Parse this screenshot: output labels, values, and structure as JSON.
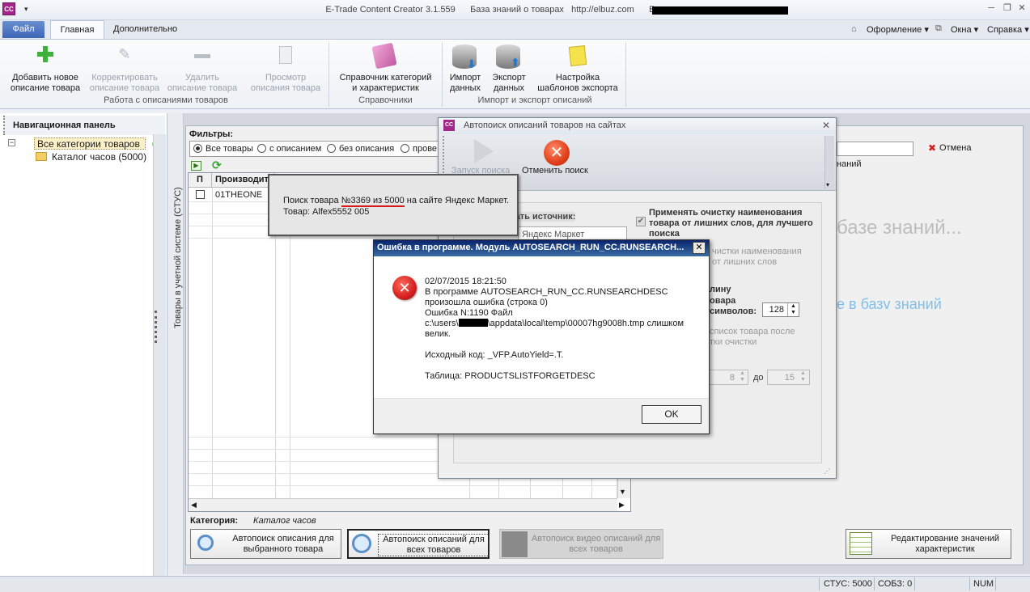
{
  "titlebar": {
    "app_icon": "CC",
    "quick_access": "▾",
    "title": "E-Trade Content Creator 3.1.559      База знаний о товарах   http://elbuz.com      База данных:"
  },
  "tabs": {
    "file": "Файл",
    "home": "Главная",
    "more": "Дополнительно",
    "right": [
      "Оформление ▾",
      "Окна ▾",
      "Справка ▾"
    ]
  },
  "ribbon": {
    "add": [
      "Добавить новое",
      "описание товара"
    ],
    "edit": [
      "Корректировать",
      "описание товара"
    ],
    "delete": [
      "Удалить",
      "описание товара"
    ],
    "view": [
      "Просмотр",
      "описания товара"
    ],
    "refs": [
      "Справочник категорий",
      "и характеристик"
    ],
    "import": [
      "Импорт",
      "данных"
    ],
    "export": [
      "Экспорт",
      "данных"
    ],
    "templates": [
      "Настройка",
      "шаблонов экспорта"
    ],
    "group1": "Работа с описаниями товаров",
    "group2": "Справочники",
    "group3": "Импорт и экспорт описаний"
  },
  "nav": {
    "header": "Навигационная панель",
    "all_categories": "Все категории товаров",
    "watch_catalog": "Каталог часов (5000)",
    "vertical_tab": "Товары в учетной системе (СТУС)"
  },
  "filters": {
    "label": "Фильтры:",
    "options": [
      "Все товары",
      "с описанием",
      "без описания",
      "прове"
    ]
  },
  "grid": {
    "col_p": "П",
    "col_maker": "Производит",
    "row1_maker": "01THEONE"
  },
  "category": {
    "label": "Категория:",
    "value": "Каталог часов"
  },
  "bottom_buttons": {
    "autosearch_selected": [
      "Автопоиск описания для",
      "выбранного товара"
    ],
    "autosearch_all": [
      "Автопоиск описаний для",
      "всех товаров"
    ],
    "autosearch_video": [
      "Автопоиск видео описаний для",
      "всех товаров"
    ],
    "edit_values": [
      "Редактирование значений",
      "характеристик"
    ]
  },
  "autosearch": {
    "title": "Автопоиск описаний товаров на сайтах",
    "start": "Запуск поиска",
    "cancel": "Отменить поиск",
    "source_label": "вать источник:",
    "source_value": "Яндекс Маркет",
    "apply_clean": "Применять очистку наименования товара от лишних слов, для лучшего поиска",
    "clean_opt1": "чистки наименования",
    "clean_opt1b": "от лишних слов",
    "length_a": "лину",
    "length_b": "овара",
    "length_c": "символов:",
    "length_value": "128",
    "list_opt": "список товара после",
    "list_opt2": "тки очистки",
    "range_from": "8",
    "range_to_label": "до",
    "range_to": "15"
  },
  "background_right": {
    "cancel": "Отмена",
    "knowledge_partial": "наний",
    "big_text": "базе знаний...",
    "blue_text": "е в базv знаний"
  },
  "progress": {
    "line1_pre": "Поиск товара ",
    "line1_num": "№3369 из 5000",
    "line1_post": " на сайте Яндекс Маркет.",
    "line2": "Товар:  Alfex5552 005"
  },
  "error": {
    "title": "Ошибка в программе. Модуль AUTOSEARCH_RUN_CC.RUNSEARCH...",
    "datetime": "02/07/2015 18:21:50",
    "l1": "В программе AUTOSEARCH_RUN_CC.RUNSEARCHDESC",
    "l2": "произошла ошибка (строка 0)",
    "l3": "Ошибка N:1190 Файл",
    "l4a": "c:\\users\\",
    "l4b": "\\appdata\\local\\temp\\00007hg9008h.tmp слишком",
    "l5": "велик.",
    "source": "Исходный код: _VFP.AutoYield=.T.",
    "table": "Таблица: PRODUCTSLISTFORGETDESC",
    "ok": "OK",
    "close": "✕"
  },
  "status": {
    "stus": "СТУС: 5000",
    "sobz": "СОБЗ: 0",
    "num": "NUM"
  },
  "colors": {
    "accent": "#3d66b8",
    "error_red": "#d22020",
    "brand": "#a3268b"
  }
}
